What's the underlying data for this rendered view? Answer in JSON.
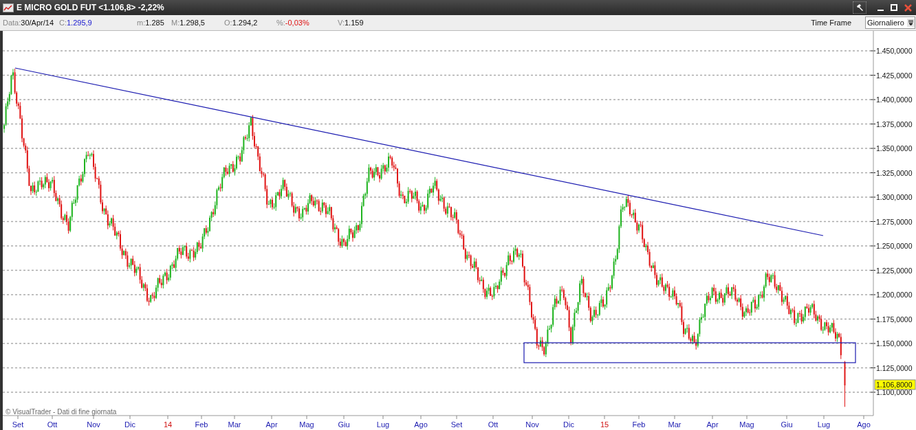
{
  "window": {
    "title": "E MICRO GOLD FUT <1.106,8> -2,22%"
  },
  "info_bar": {
    "fields": [
      {
        "label": "Data:",
        "value": "30/Apr/14",
        "kind": "plain"
      },
      {
        "label": "C:",
        "value": "1.295,9",
        "kind": "close"
      },
      {
        "label": "m:",
        "value": "1.285",
        "kind": "plain"
      },
      {
        "label": "M:",
        "value": "1.298,5",
        "kind": "plain"
      },
      {
        "label": "O:",
        "value": "1.294,2",
        "kind": "plain"
      },
      {
        "label": "%:",
        "value": "-0,03%",
        "kind": "change"
      },
      {
        "label": "V:",
        "value": "1.159",
        "kind": "plain"
      }
    ],
    "time_frame_label": "Time Frame",
    "time_frame": "Giornaliero"
  },
  "chart": {
    "y_ticks": [
      "1.450,0000",
      "1.425,0000",
      "1.400,0000",
      "1.375,0000",
      "1.350,0000",
      "1.325,0000",
      "1.300,0000",
      "1.275,0000",
      "1.250,0000",
      "1.225,0000",
      "1.200,0000",
      "1.175,0000",
      "1.150,0000",
      "1.125,0000",
      "1.100,0000"
    ],
    "last_price": "1.106,8000",
    "credit": "© VisualTrader - Dati di fine giornata",
    "x_ticks": [
      {
        "label": "Set",
        "kind": "month"
      },
      {
        "label": "Ott",
        "kind": "month"
      },
      {
        "label": "Nov",
        "kind": "month"
      },
      {
        "label": "Dic",
        "kind": "month"
      },
      {
        "label": "14",
        "kind": "year"
      },
      {
        "label": "Feb",
        "kind": "month"
      },
      {
        "label": "Mar",
        "kind": "month"
      },
      {
        "label": "Apr",
        "kind": "month"
      },
      {
        "label": "Mag",
        "kind": "month"
      },
      {
        "label": "Giu",
        "kind": "month"
      },
      {
        "label": "Lug",
        "kind": "month"
      },
      {
        "label": "Ago",
        "kind": "month"
      },
      {
        "label": "Set",
        "kind": "month"
      },
      {
        "label": "Ott",
        "kind": "month"
      },
      {
        "label": "Nov",
        "kind": "month"
      },
      {
        "label": "Dic",
        "kind": "month"
      },
      {
        "label": "15",
        "kind": "year"
      },
      {
        "label": "Feb",
        "kind": "month"
      },
      {
        "label": "Mar",
        "kind": "month"
      },
      {
        "label": "Apr",
        "kind": "month"
      },
      {
        "label": "Mag",
        "kind": "month"
      },
      {
        "label": "Giu",
        "kind": "month"
      },
      {
        "label": "Lug",
        "kind": "month"
      },
      {
        "label": "Ago",
        "kind": "month"
      }
    ]
  }
}
